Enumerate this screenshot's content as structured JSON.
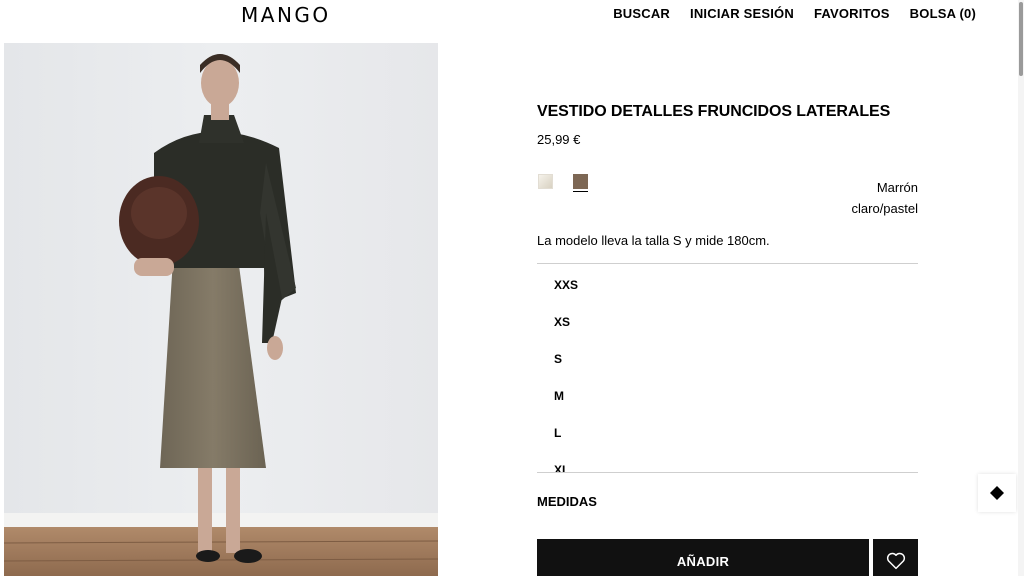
{
  "header": {
    "logo": "MANGO",
    "nav": {
      "search": "BUSCAR",
      "login": "INICIAR SESIÓN",
      "favorites": "FAVORITOS",
      "bag": "BOLSA (0)"
    }
  },
  "product": {
    "title": "VESTIDO DETALLES FRUNCIDOS LATERALES",
    "price": "25,99 €",
    "colors": [
      {
        "name": "light-swatch",
        "hex": "#e8e2d6"
      },
      {
        "name": "brown-swatch",
        "hex": "#7d6754",
        "selected": true
      }
    ],
    "selected_color_line1": "Marrón",
    "selected_color_line2": "claro/pastel",
    "model_note": "La modelo lleva la talla S y mide 180cm.",
    "sizes": [
      "XXS",
      "XS",
      "S",
      "M",
      "L",
      "XL"
    ],
    "measures_label": "MEDIDAS",
    "add_label": "AÑADIR",
    "favorite_icon": "heart-icon"
  },
  "floating_widget_icon": "diamond-icon",
  "colors": {
    "button_bg": "#111111",
    "image_bg": "#e9eaec"
  }
}
